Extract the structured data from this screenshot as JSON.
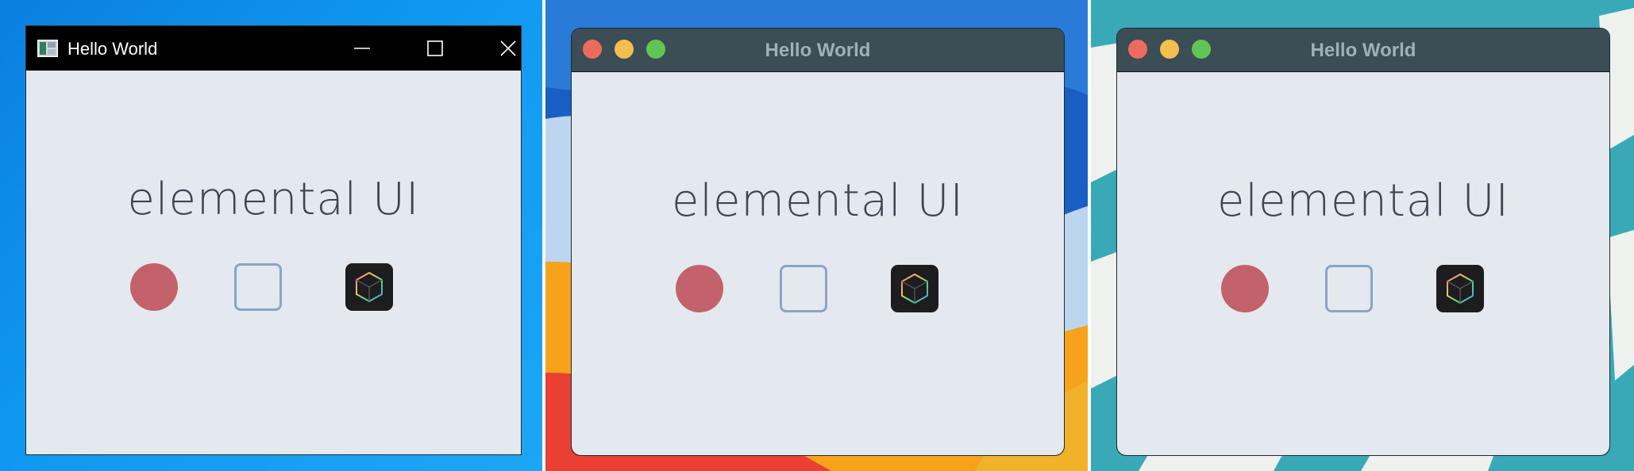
{
  "windows": {
    "win": {
      "title": "Hello World",
      "app_icon": "app-window-icon",
      "buttons": [
        "minimize-icon",
        "maximize-icon",
        "close-icon"
      ],
      "hero": "elemental UI"
    },
    "mac1": {
      "title": "Hello World",
      "traffic_lights": [
        "close",
        "minimize",
        "zoom"
      ],
      "hero": "elemental UI"
    },
    "mac2": {
      "title": "Hello World",
      "traffic_lights": [
        "close",
        "minimize",
        "zoom"
      ],
      "hero": "elemental UI"
    }
  },
  "controls": [
    {
      "kind": "circle-button",
      "color": "#c4626b"
    },
    {
      "kind": "square-outline-button",
      "color": "#8aa4c6"
    },
    {
      "kind": "cube-app-icon",
      "color": "#1d1d1f"
    }
  ],
  "colors": {
    "content_bg": "#e4e9ef",
    "hero_text": "#3e4553",
    "traffic_close": "#ed6a5e",
    "traffic_minimize": "#f5bf4f",
    "traffic_zoom": "#61c554"
  }
}
